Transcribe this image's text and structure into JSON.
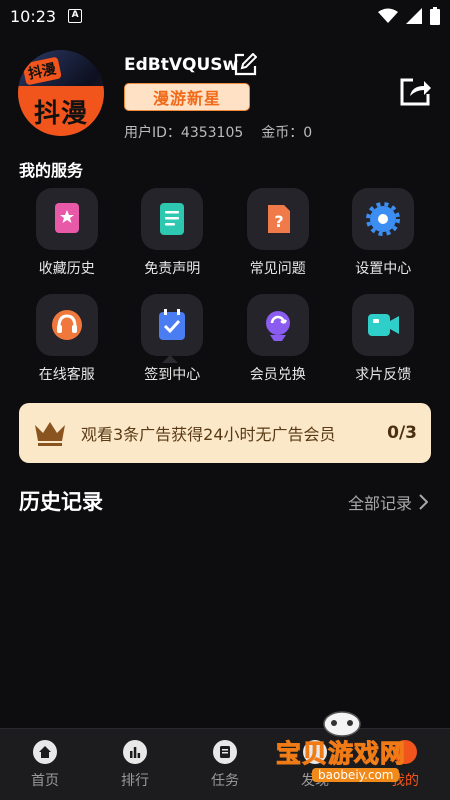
{
  "status": {
    "time": "10:23",
    "indicator": "A"
  },
  "profile": {
    "avatar_badge": "抖漫",
    "username": "EdBtVQUSw",
    "level": "漫游新星",
    "uid_label": "用户ID：4353105",
    "coins_label": "金币：0"
  },
  "services": {
    "title": "我的服务",
    "items": [
      {
        "label": "收藏历史",
        "icon": "bookmark-icon",
        "color": "#e85aa8"
      },
      {
        "label": "免责声明",
        "icon": "document-icon",
        "color": "#2ec7b0"
      },
      {
        "label": "常见问题",
        "icon": "question-icon",
        "color": "#f07a4a"
      },
      {
        "label": "设置中心",
        "icon": "gear-icon",
        "color": "#3c8ef2"
      },
      {
        "label": "在线客服",
        "icon": "headset-icon",
        "color": "#f0783c"
      },
      {
        "label": "签到中心",
        "icon": "checkin-icon",
        "color": "#4a7cf2"
      },
      {
        "label": "会员兑换",
        "icon": "exchange-icon",
        "color": "#8a5cf0"
      },
      {
        "label": "求片反馈",
        "icon": "video-icon",
        "color": "#2ecfc8"
      }
    ]
  },
  "promo": {
    "text": "观看3条广告获得24小时无广告会员",
    "count": "0/3"
  },
  "history": {
    "title": "历史记录",
    "all_label": "全部记录"
  },
  "nav": [
    {
      "label": "首页",
      "icon": "home-icon"
    },
    {
      "label": "排行",
      "icon": "chart-icon"
    },
    {
      "label": "任务",
      "icon": "task-icon"
    },
    {
      "label": "发现",
      "icon": "discover-icon"
    },
    {
      "label": "我的",
      "icon": "profile-icon"
    }
  ],
  "watermark": {
    "title": "宝贝游戏网",
    "url": "baobeiy.com"
  },
  "colors": {
    "accent": "#f2551c",
    "promo_bg": "#fbe8c9",
    "background": "#0d0d0f"
  }
}
